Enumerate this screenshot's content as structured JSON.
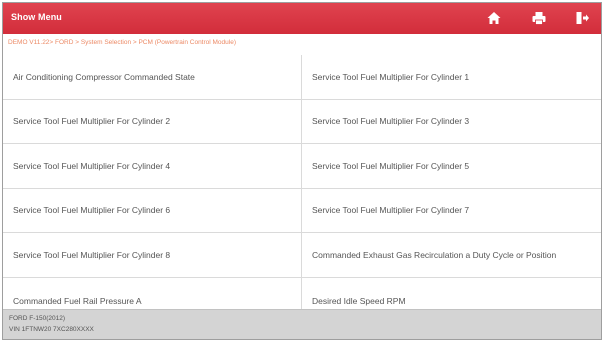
{
  "header": {
    "title": "Show Menu",
    "background_color": "#d9303d",
    "icons": [
      "home-icon",
      "print-icon",
      "exit-icon"
    ]
  },
  "breadcrumb": "DEMO V11.22> FORD > System Selection > PCM (Powertrain Control Module)",
  "items": [
    "Air Conditioning Compressor Commanded State",
    "Service Tool Fuel Multiplier For Cylinder 1",
    "Service Tool Fuel Multiplier For Cylinder 2",
    "Service Tool Fuel Multiplier For Cylinder 3",
    "Service Tool Fuel Multiplier For Cylinder 4",
    "Service Tool Fuel Multiplier For Cylinder 5",
    "Service Tool Fuel Multiplier For Cylinder 6",
    "Service Tool Fuel Multiplier For Cylinder 7",
    "Service Tool Fuel Multiplier For Cylinder 8",
    "Commanded Exhaust Gas Recirculation a Duty Cycle or Position",
    "Commanded Fuel Rail Pressure A",
    "Desired Idle Speed RPM"
  ],
  "footer": {
    "line1": "FORD F-150(2012)",
    "line2": "VIN 1FTNW20 7XC280XXXX"
  }
}
